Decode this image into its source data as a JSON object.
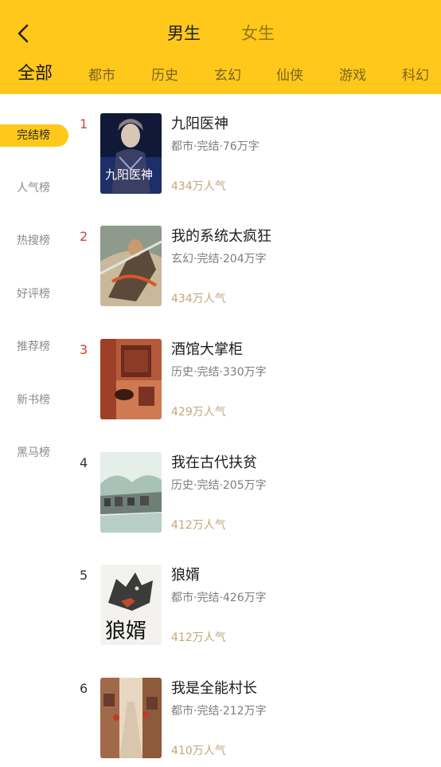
{
  "header": {
    "tabs": [
      {
        "label": "男生",
        "active": true
      },
      {
        "label": "女生",
        "active": false
      }
    ],
    "categories": [
      {
        "label": "全部",
        "active": true
      },
      {
        "label": "都市"
      },
      {
        "label": "历史"
      },
      {
        "label": "玄幻"
      },
      {
        "label": "仙侠"
      },
      {
        "label": "游戏"
      },
      {
        "label": "科幻"
      }
    ],
    "accent_color": "#FFC81A"
  },
  "side_menu": [
    {
      "label": "完结榜",
      "active": true
    },
    {
      "label": "人气榜"
    },
    {
      "label": "热搜榜"
    },
    {
      "label": "好评榜"
    },
    {
      "label": "推荐榜"
    },
    {
      "label": "新书榜"
    },
    {
      "label": "黑马榜"
    }
  ],
  "books": [
    {
      "rank": "1",
      "title": "九阳医神",
      "meta": "都市·完结·76万字",
      "popularity": "434万人气",
      "cover_text": "九阳医神"
    },
    {
      "rank": "2",
      "title": "我的系统太疯狂",
      "meta": "玄幻·完结·204万字",
      "popularity": "434万人气"
    },
    {
      "rank": "3",
      "title": "酒馆大掌柜",
      "meta": "历史·完结·330万字",
      "popularity": "429万人气"
    },
    {
      "rank": "4",
      "title": "我在古代扶贫",
      "meta": "历史·完结·205万字",
      "popularity": "412万人气"
    },
    {
      "rank": "5",
      "title": "狼婿",
      "meta": "都市·完结·426万字",
      "popularity": "412万人气",
      "cover_text": "狼婿"
    },
    {
      "rank": "6",
      "title": "我是全能村长",
      "meta": "都市·完结·212万字",
      "popularity": "410万人气"
    }
  ]
}
